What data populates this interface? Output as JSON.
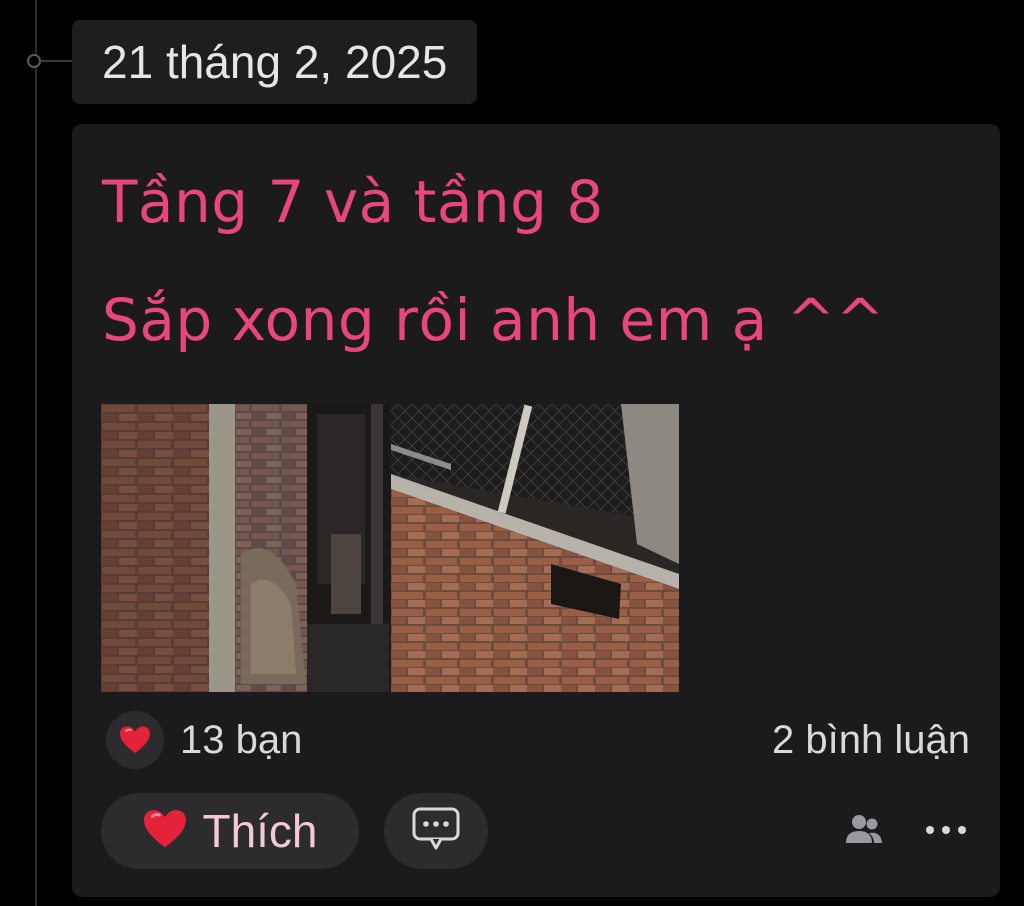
{
  "date_header": {
    "label": "21 tháng 2, 2025"
  },
  "post": {
    "lines": [
      "Tầng 7 và tầng 8",
      "Sắp xong rồi anh em ạ ^^"
    ],
    "text_color": "#e8467c",
    "photos": [
      {
        "subject": "brick wall corridor"
      },
      {
        "subject": "brick wall with steel beams"
      }
    ]
  },
  "reactions": {
    "icon": "heart-icon",
    "count_label": "13 bạn",
    "comments_label": "2 bình luận"
  },
  "actions": {
    "like_label": "Thích",
    "like_icon": "heart-icon",
    "comment_icon": "comment-bubble-icon",
    "audience_icon": "people-icon",
    "more_icon": "more-icon"
  },
  "colors": {
    "background": "#000000",
    "card": "#1b1b1d",
    "accent": "#e8467c",
    "button_bg": "#2c2c2e"
  }
}
